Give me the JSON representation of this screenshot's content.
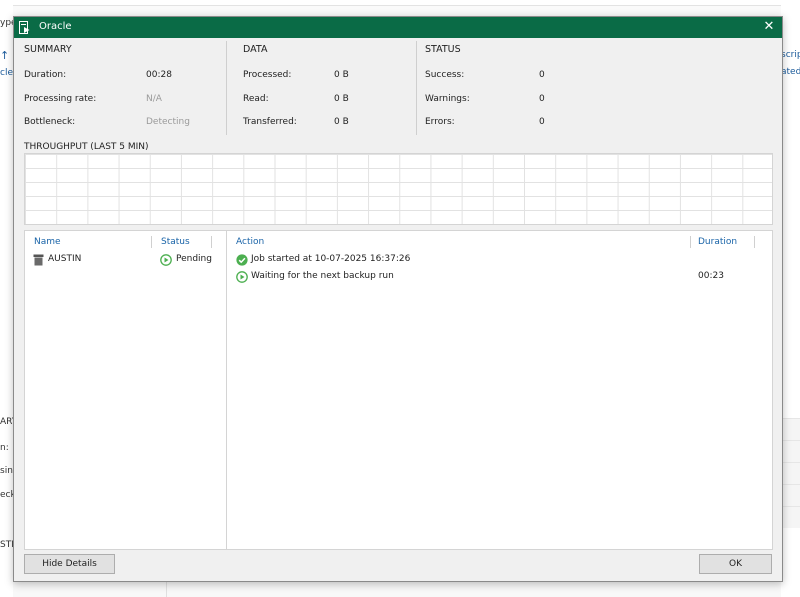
{
  "background": {
    "left_fragments": [
      "ype",
      "cle",
      "ARY",
      "n:",
      "sing",
      "eck",
      "STIN"
    ],
    "right_fragments": [
      "script",
      "ated"
    ]
  },
  "dialog": {
    "title": "Oracle",
    "close_glyph": "✕",
    "summary": {
      "heading": "SUMMARY",
      "duration_label": "Duration:",
      "duration_value": "00:28",
      "rate_label": "Processing rate:",
      "rate_value": "N/A",
      "bottleneck_label": "Bottleneck:",
      "bottleneck_value": "Detecting"
    },
    "data": {
      "heading": "DATA",
      "processed_label": "Processed:",
      "processed_value": "0 B",
      "read_label": "Read:",
      "read_value": "0 B",
      "transferred_label": "Transferred:",
      "transferred_value": "0 B"
    },
    "status": {
      "heading": "STATUS",
      "success_label": "Success:",
      "success_value": "0",
      "warnings_label": "Warnings:",
      "warnings_value": "0",
      "errors_label": "Errors:",
      "errors_value": "0"
    },
    "throughput_label": "THROUGHPUT (LAST 5 MIN)",
    "objects": {
      "col_name": "Name",
      "col_status": "Status",
      "rows": [
        {
          "name": "AUSTIN",
          "status": "Pending"
        }
      ]
    },
    "actions": {
      "col_action": "Action",
      "col_duration": "Duration",
      "rows": [
        {
          "text": "Job started at 10-07-2025 16:37:26",
          "duration": "",
          "icon": "success-check-icon"
        },
        {
          "text": "Waiting for the next backup run",
          "duration": "00:23",
          "icon": "pending-play-icon"
        }
      ]
    },
    "buttons": {
      "hide_details": "Hide Details",
      "ok": "OK"
    }
  },
  "colors": {
    "titlebar": "#0a6b46",
    "success_green": "#4caf50",
    "link_blue": "#1a64a8"
  }
}
